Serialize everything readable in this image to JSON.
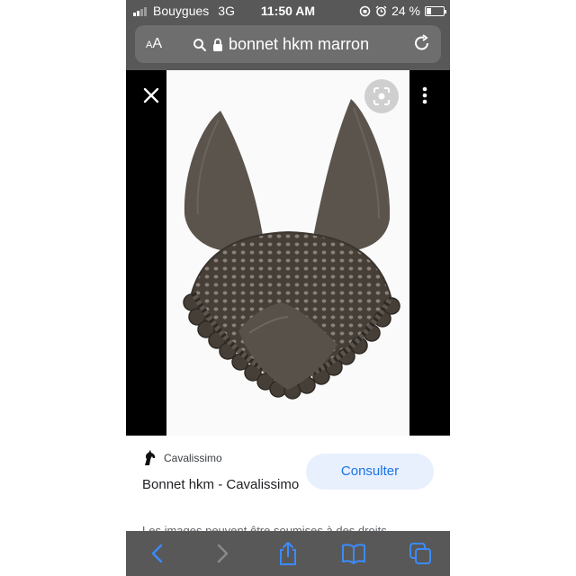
{
  "status_bar": {
    "carrier": "Bouygues",
    "network": "3G",
    "time": "11:50 AM",
    "battery": "24 %",
    "battery_level": 0.24
  },
  "address_bar": {
    "text_size_label": "AA",
    "url": "bonnet hkm marron"
  },
  "result": {
    "source": "Cavalissimo",
    "title": "Bonnet hkm - Cavalissimo",
    "action_label": "Consulter",
    "disclaimer": "Les images peuvent être soumises à des droits"
  },
  "icons": {
    "close": "close-icon",
    "lens": "lens-icon",
    "more": "more-vert-icon",
    "lock": "lock-icon",
    "search": "search-icon",
    "reload": "reload-icon",
    "source_logo": "horse-logo-icon",
    "back": "back-icon",
    "forward": "forward-icon",
    "share": "share-icon",
    "bookmarks": "bookmarks-icon",
    "tabs": "tabs-icon"
  },
  "colors": {
    "browser_chrome": "#585858",
    "accent": "#1a73e8",
    "consult_bg": "#e8f0fe"
  }
}
